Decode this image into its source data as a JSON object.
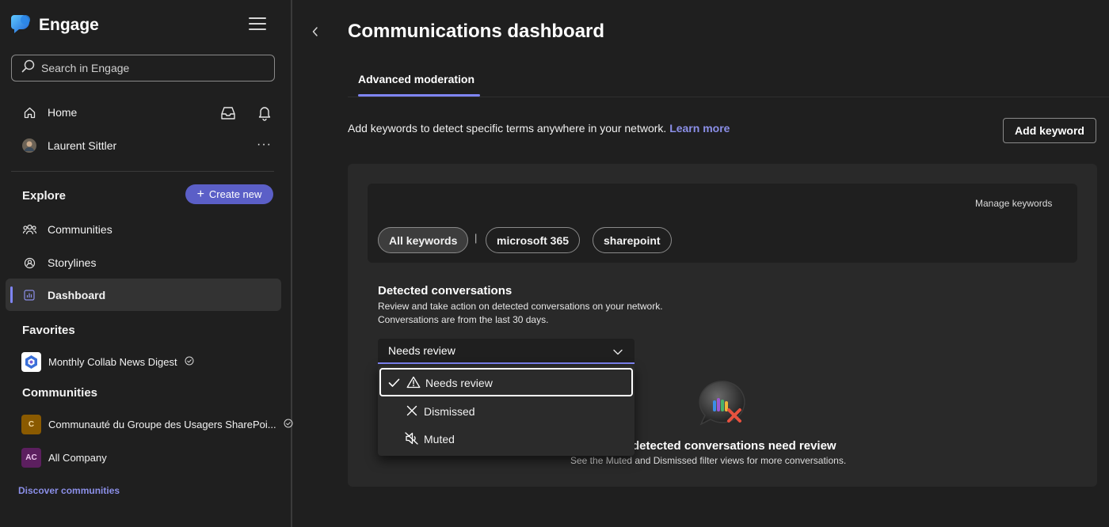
{
  "app": {
    "title": "Engage"
  },
  "search": {
    "placeholder": "Search in Engage"
  },
  "nav": {
    "home": "Home",
    "user": "Laurent Sittler",
    "more": "···"
  },
  "explore": {
    "heading": "Explore",
    "create_new": "Create new",
    "items": [
      {
        "label": "Communities"
      },
      {
        "label": "Storylines"
      },
      {
        "label": "Dashboard"
      }
    ]
  },
  "favorites": {
    "heading": "Favorites",
    "items": [
      {
        "label": "Monthly Collab News Digest"
      }
    ]
  },
  "communities": {
    "heading": "Communities",
    "items": [
      {
        "label": "Communauté du Groupe des Usagers SharePoi...",
        "initials": "C",
        "color": "#8a5a00"
      },
      {
        "label": "All Company",
        "initials": "AC",
        "color": "#5c1f5f"
      }
    ],
    "discover": "Discover communities"
  },
  "main": {
    "title": "Communications dashboard",
    "tab": "Advanced moderation",
    "description": "Add keywords to detect specific terms anywhere in your network.",
    "learn_more": "Learn more",
    "add_keyword": "Add keyword",
    "manage_keywords": "Manage keywords",
    "chips": [
      {
        "label": "All keywords"
      },
      {
        "label": "microsoft 365"
      },
      {
        "label": "sharepoint"
      }
    ],
    "chip_separator": "|",
    "detected": {
      "title": "Detected conversations",
      "line1": "Review and take action on detected conversations on your network.",
      "line2": "Conversations are from the last 30 days."
    },
    "filter": {
      "selected": "Needs review",
      "options": [
        {
          "label": "Needs review"
        },
        {
          "label": "Dismissed"
        },
        {
          "label": "Muted"
        }
      ]
    },
    "empty": {
      "title": "detected conversations need review",
      "subtitle": "See the Muted and Dismissed filter views for more conversations."
    }
  },
  "colors": {
    "accent": "#7f85f5",
    "create_button": "#5b5fc7",
    "link": "#8b8fe8"
  }
}
